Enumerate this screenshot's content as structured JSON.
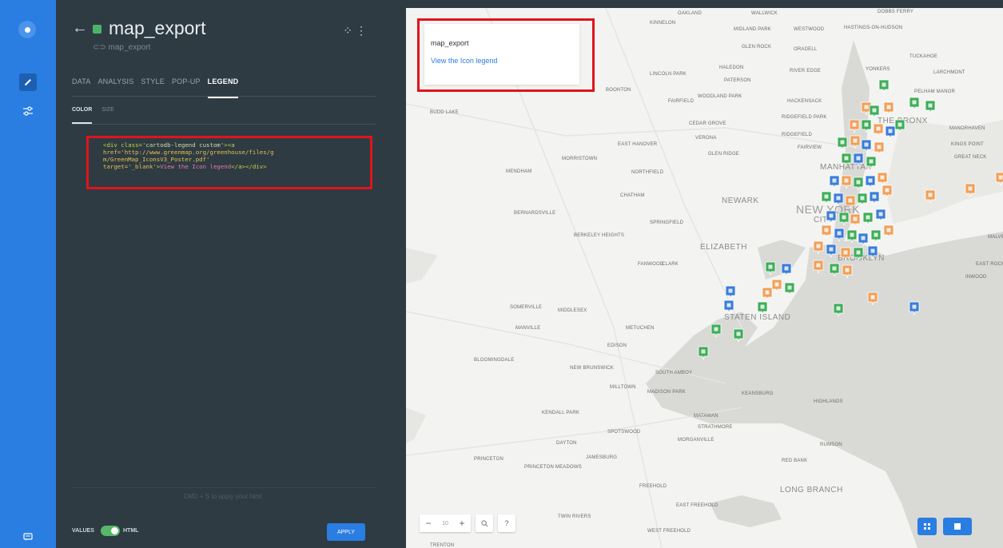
{
  "rail": {
    "logo": "carto-logo-icon",
    "tools": [
      "pencil-icon",
      "settings-sliders-icon"
    ],
    "bottom": "chat-icon"
  },
  "panel": {
    "title": "map_export",
    "subtitle": "⊂⊃ map_export",
    "tabs": [
      {
        "label": "DATA",
        "active": false
      },
      {
        "label": "ANALYSIS",
        "active": false
      },
      {
        "label": "STYLE",
        "active": false
      },
      {
        "label": "POP-UP",
        "active": false
      },
      {
        "label": "LEGEND",
        "active": true
      }
    ],
    "subtabs": [
      {
        "label": "COLOR",
        "active": true
      },
      {
        "label": "SIZE",
        "active": false
      }
    ],
    "code": {
      "l1_open": "<div class=",
      "l1_class": "'cartodb-legend custom'",
      "l1_a": "><a",
      "l2": "href='http://www.greenmap.org/greenhouse/files/g",
      "l3": "m/GreenMap_IconsV3_Poster.pdf'",
      "l4_target": "target='_blank'>",
      "l4_text": "View the Icon legend",
      "l4_close": "</a></div>"
    },
    "hint": "CMD + S to apply your html",
    "footer": {
      "values_label": "VALUES",
      "html_label": "HTML",
      "apply_label": "APPLY"
    }
  },
  "map": {
    "legend": {
      "title": "map_export",
      "link": "View the Icon legend"
    },
    "zoom": {
      "level": "10",
      "minus": "−",
      "plus": "+"
    },
    "places": [
      "OAKLAND",
      "WALLWICK",
      "DOBBS FERRY",
      "KINNELON",
      "MIDLAND PARK",
      "WESTWOOD",
      "HASTINGS-ON-HUDSON",
      "GLEN ROCK",
      "ORADELL",
      "TUCKAHOE",
      "LINCOLN PARK",
      "HALEDON",
      "RIVER EDGE",
      "YONKERS",
      "LARCHMONT",
      "PATERSON",
      "BOONTON",
      "FAIRFIELD",
      "WOODLAND PARK",
      "HACKENSACK",
      "PELHAM MANOR",
      "BUDD LAKE",
      "CEDAR GROVE",
      "RIDGEFIELD PARK",
      "THE BRONX",
      "MANORHAVEN",
      "VERONA",
      "RIDGEFIELD",
      "KINGS POINT",
      "EAST HANOVER",
      "FAIRVIEW",
      "GREAT NECK",
      "GLEN RIDGE",
      "MORRISTOWN",
      "MANHATTAN",
      "MENDHAM",
      "NORTHFIELD",
      "CHATHAM",
      "NEWARK",
      "NEW YORK",
      "CITY",
      "BERNARDSVILLE",
      "SPRINGFIELD",
      "BERKELEY HEIGHTS",
      "ELIZABETH",
      "BROOKLYN",
      "FANWOOD",
      "CLARK",
      "EAST ROCKAWAY",
      "INWOOD",
      "SOMERVILLE",
      "MIDDLESEX",
      "STATEN ISLAND",
      "MANVILLE",
      "METUCHEN",
      "EDISON",
      "BLOOMINGDALE",
      "NEW BRUNSWICK",
      "SOUTH AMBOY",
      "MILLTOWN",
      "MADISON PARK",
      "KEANSBURG",
      "KENDALL PARK",
      "MATAWAN",
      "HIGHLANDS",
      "SPOTSWOOD",
      "STRATHMORE",
      "RUMSON",
      "DAYTON",
      "MORGANVILLE",
      "PRINCETON",
      "JAMESBURG",
      "RED BANK",
      "PRINCETON MEADOWS",
      "LONG BRANCH",
      "FREEHOLD",
      "EAST FREEHOLD",
      "TWIN RIVERS",
      "WEST FREEHOLD",
      "MALVERNE",
      "TRENTON"
    ],
    "marker_colors": {
      "green": "#3fae5a",
      "orange": "#f0a05a",
      "blue": "#3b7dd8"
    }
  },
  "colors": {
    "rail": "#2a7de1",
    "panel": "#2e3b43",
    "highlight": "#e0141a",
    "accent": "#2a7de1"
  }
}
